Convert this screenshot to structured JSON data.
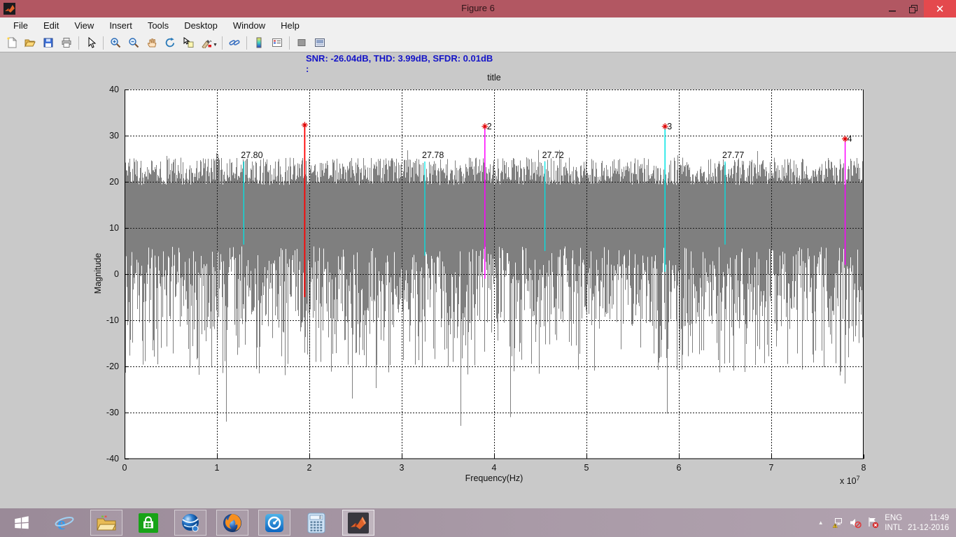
{
  "window": {
    "title": "Figure 6",
    "controls": [
      "minimize-icon",
      "restore-icon",
      "close-icon"
    ],
    "titlebar_color": "#b25762",
    "close_button_color": "#e4494d"
  },
  "menu": {
    "items": [
      "File",
      "Edit",
      "View",
      "Insert",
      "Tools",
      "Desktop",
      "Window",
      "Help"
    ]
  },
  "toolbar": {
    "icons": [
      "new-file",
      "open-file",
      "save-figure",
      "print-figure",
      "separator",
      "pointer",
      "separator",
      "zoom-in",
      "zoom-out",
      "pan",
      "rotate-3d",
      "data-cursor",
      "brush",
      "separator",
      "link-plot",
      "separator",
      "insert-colorbar",
      "insert-legend",
      "separator",
      "hide-plot-tools",
      "show-plot-tools"
    ]
  },
  "figure": {
    "annotation_line1": "SNR: -26.04dB, THD: 3.99dB, SFDR: 0.01dB",
    "annotation_line2": ":",
    "annotation_color": "#1414c8",
    "background_color": "#c9c9c9"
  },
  "chart_data": {
    "type": "line",
    "subtype": "spectrum-with-stems",
    "title": "title",
    "xlabel": "Frequency(Hz)",
    "ylabel": "Magnitude",
    "x_multiplier": {
      "prefix": "x 10",
      "exp": "7"
    },
    "xlim_e7": [
      0,
      8
    ],
    "ylim": [
      -40,
      40
    ],
    "xticks": [
      "0",
      "1",
      "2",
      "3",
      "4",
      "5",
      "6",
      "7",
      "8"
    ],
    "yticks": [
      "40",
      "30",
      "20",
      "10",
      "0",
      "-10",
      "-20",
      "-30",
      "-40"
    ],
    "grid": true,
    "noise": {
      "color": "#7f7f7f",
      "top_db_typical": 22,
      "top_db_max": 26,
      "band_bottom_db": -4,
      "spike_min_db": -35
    },
    "fundamental": {
      "freq_e7": 1.95,
      "top_db": 32.3,
      "bottom_db": -5,
      "color": "#ff0000",
      "marker": "red-plus"
    },
    "harmonics": [
      {
        "label": "2",
        "freq_e7": 3.9,
        "top_db": 32.0,
        "bottom_db": -1,
        "color": "#ff00ff",
        "marker": "red-plus"
      },
      {
        "label": "3",
        "freq_e7": 5.85,
        "top_db": 32.0,
        "bottom_db": 0.5,
        "color": "#00e5e5",
        "marker": "red-plus"
      },
      {
        "label": "4",
        "freq_e7": 7.8,
        "top_db": 29.3,
        "bottom_db": 2,
        "color": "#ff00ff",
        "marker": "red-plus"
      }
    ],
    "spurs": [
      {
        "label": "27.80",
        "freq_e7": 1.29,
        "top_db": 24.4,
        "bottom_db": 6.4
      },
      {
        "label": "27.78",
        "freq_e7": 3.25,
        "top_db": 24.4,
        "bottom_db": 4.0
      },
      {
        "label": "27.72",
        "freq_e7": 4.55,
        "top_db": 24.4,
        "bottom_db": 5.0
      },
      {
        "label": "27.77",
        "freq_e7": 6.5,
        "top_db": 24.4,
        "bottom_db": 6.4
      }
    ],
    "spur_color": "#00e5e5"
  },
  "taskbar": {
    "items": [
      {
        "name": "start-button",
        "open": false,
        "active": false
      },
      {
        "name": "internet-explorer",
        "open": false,
        "active": false
      },
      {
        "name": "file-explorer",
        "open": true,
        "active": false
      },
      {
        "name": "windows-store",
        "open": false,
        "active": false
      },
      {
        "name": "globe-app",
        "open": true,
        "active": false
      },
      {
        "name": "firefox",
        "open": true,
        "active": false
      },
      {
        "name": "media-app",
        "open": true,
        "active": false
      },
      {
        "name": "calculator",
        "open": false,
        "active": false
      },
      {
        "name": "matlab",
        "open": true,
        "active": true
      }
    ],
    "tray": {
      "chevron": "▲",
      "icons": [
        "network-warning-icon",
        "speaker-muted-icon",
        "flag-error-icon"
      ],
      "lang1": "ENG",
      "lang2": "INTL",
      "time": "11:49",
      "date": "21-12-2016"
    }
  }
}
